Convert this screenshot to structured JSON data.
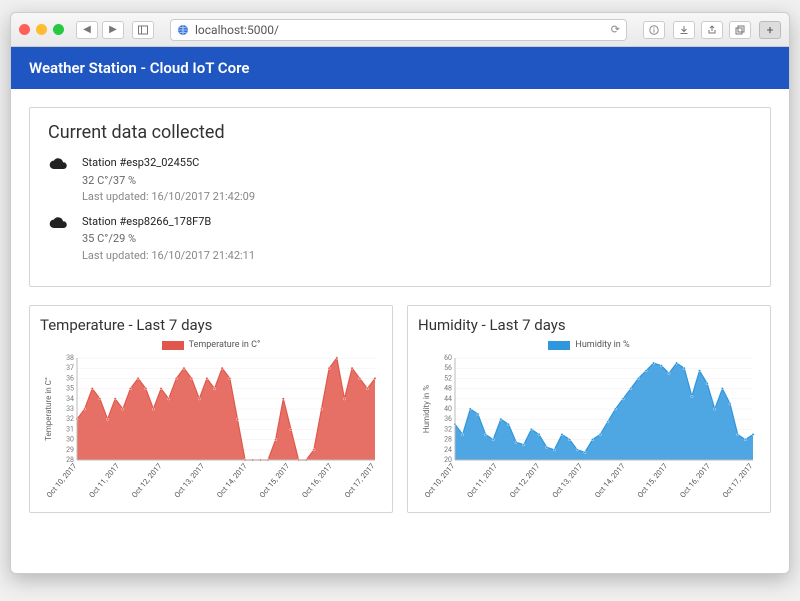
{
  "browser": {
    "url": "localhost:5000/"
  },
  "banner": {
    "title": "Weather Station - Cloud IoT Core"
  },
  "current": {
    "heading": "Current data collected",
    "stations": [
      {
        "name": "Station #esp32_02455C",
        "reading": "32 C°/37 %",
        "updated": "Last updated: 16/10/2017 21:42:09"
      },
      {
        "name": "Station #esp8266_178F7B",
        "reading": "35 C°/29 %",
        "updated": "Last updated: 16/10/2017 21:42:11"
      }
    ]
  },
  "charts": {
    "temperature": {
      "title": "Temperature - Last 7 days",
      "legend": "Temperature in C°",
      "ylabel": "Temperature in C°",
      "color": "#e2574b"
    },
    "humidity": {
      "title": "Humidity - Last 7 days",
      "legend": "Humidity in %",
      "ylabel": "Humidity in %",
      "color": "#2f97dd"
    }
  },
  "chart_data": [
    {
      "type": "area",
      "title": "Temperature - Last 7 days",
      "xlabel": "",
      "ylabel": "Temperature in C°",
      "ylim": [
        28,
        38
      ],
      "x_categories": [
        "Oct 10, 2017",
        "Oct 11, 2017",
        "Oct 12, 2017",
        "Oct 13, 2017",
        "Oct 14, 2017",
        "Oct 15, 2017",
        "Oct 16, 2017",
        "Oct 17, 2017"
      ],
      "series": [
        {
          "name": "Temperature in C°",
          "color": "#e2574b",
          "values": [
            32,
            33,
            35,
            34,
            32,
            34,
            33,
            35,
            36,
            35,
            33,
            35,
            34,
            36,
            37,
            36,
            34,
            36,
            35,
            37,
            36,
            32,
            28,
            28,
            28,
            28,
            30,
            34,
            31,
            28,
            28,
            29,
            33,
            37,
            38,
            34,
            37,
            36,
            35,
            36
          ]
        }
      ]
    },
    {
      "type": "area",
      "title": "Humidity - Last 7 days",
      "xlabel": "",
      "ylabel": "Humidity in %",
      "ylim": [
        20,
        60
      ],
      "x_categories": [
        "Oct 10, 2017",
        "Oct 11, 2017",
        "Oct 12, 2017",
        "Oct 13, 2017",
        "Oct 14, 2017",
        "Oct 15, 2017",
        "Oct 16, 2017",
        "Oct 17, 2017"
      ],
      "series": [
        {
          "name": "Humidity in %",
          "color": "#2f97dd",
          "values": [
            34,
            30,
            40,
            38,
            30,
            28,
            36,
            34,
            27,
            26,
            32,
            30,
            25,
            24,
            30,
            28,
            24,
            23,
            28,
            30,
            35,
            40,
            44,
            48,
            52,
            55,
            58,
            57,
            54,
            58,
            56,
            45,
            55,
            50,
            40,
            48,
            42,
            30,
            28,
            30
          ]
        }
      ]
    }
  ]
}
